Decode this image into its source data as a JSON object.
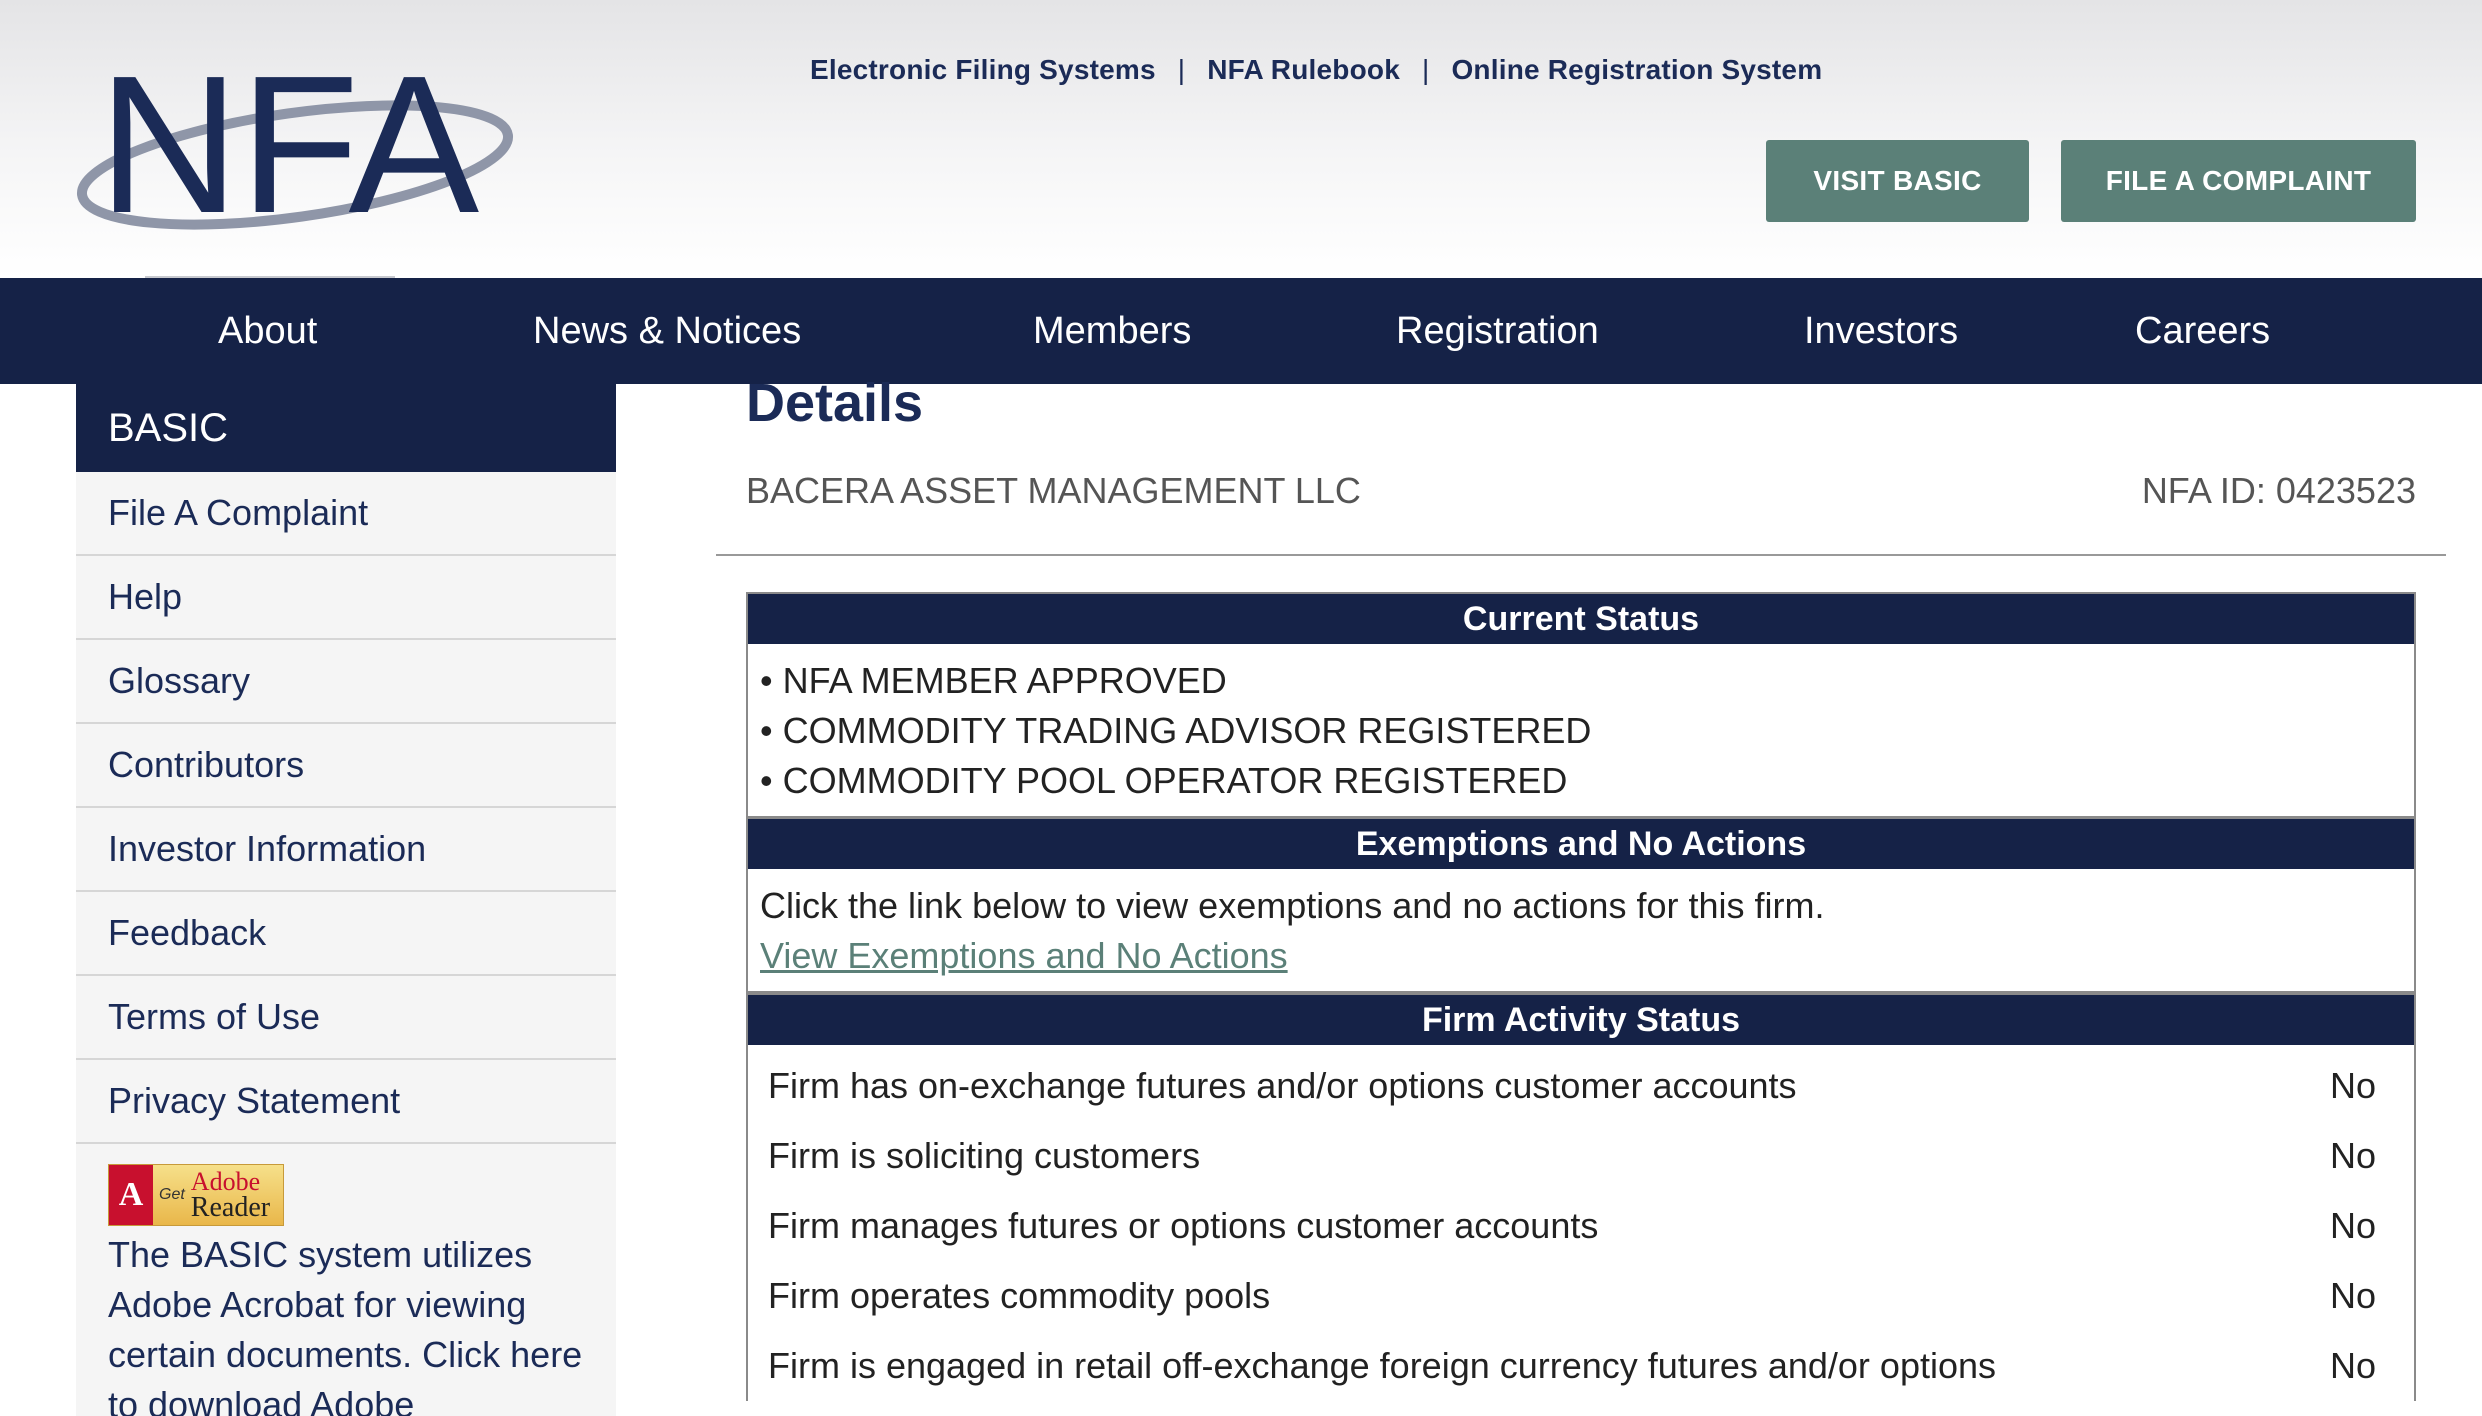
{
  "header": {
    "logo_text": "NFA",
    "top_links": [
      "Electronic Filing Systems",
      "NFA Rulebook",
      "Online Registration System"
    ],
    "link_separator": "|",
    "visit_basic_label": "VISIT BASIC",
    "file_complaint_label": "FILE A COMPLAINT"
  },
  "nav": {
    "items": [
      "About",
      "News & Notices",
      "Members",
      "Registration",
      "Investors",
      "Careers"
    ]
  },
  "sidebar": {
    "title": "BASIC",
    "items": [
      "File A Complaint",
      "Help",
      "Glossary",
      "Contributors",
      "Investor Information",
      "Feedback",
      "Terms of Use",
      "Privacy Statement"
    ],
    "adobe_badge": {
      "logo": "A",
      "small": "Adobe",
      "get": "Get",
      "line1": "Adobe",
      "line2": "Reader"
    },
    "adobe_text": "The BASIC system utilizes Adobe Acrobat for viewing certain documents. Click here to download Adobe"
  },
  "main": {
    "title": "Details",
    "firm_name": "BACERA ASSET MANAGEMENT LLC",
    "nfa_id": "NFA ID: 0423523",
    "current_status": {
      "heading": "Current Status",
      "items": [
        "NFA MEMBER APPROVED",
        "COMMODITY TRADING ADVISOR REGISTERED",
        "COMMODITY POOL OPERATOR REGISTERED"
      ]
    },
    "exemptions": {
      "heading": "Exemptions and No Actions",
      "text": "Click the link below to view exemptions and no actions for this firm.",
      "link": "View Exemptions and No Actions"
    },
    "activity": {
      "heading": "Firm Activity Status",
      "rows": [
        {
          "label": "Firm has on-exchange futures and/or options customer accounts",
          "value": "No"
        },
        {
          "label": "Firm is soliciting customers",
          "value": "No"
        },
        {
          "label": "Firm manages futures or options customer accounts",
          "value": "No"
        },
        {
          "label": "Firm operates commodity pools",
          "value": "No"
        },
        {
          "label": "Firm is engaged in retail off-exchange foreign currency futures and/or options",
          "value": "No"
        }
      ]
    }
  },
  "colors": {
    "navy": "#152247",
    "teal_button": "#5b8078",
    "link_text": "#1b2b57"
  }
}
